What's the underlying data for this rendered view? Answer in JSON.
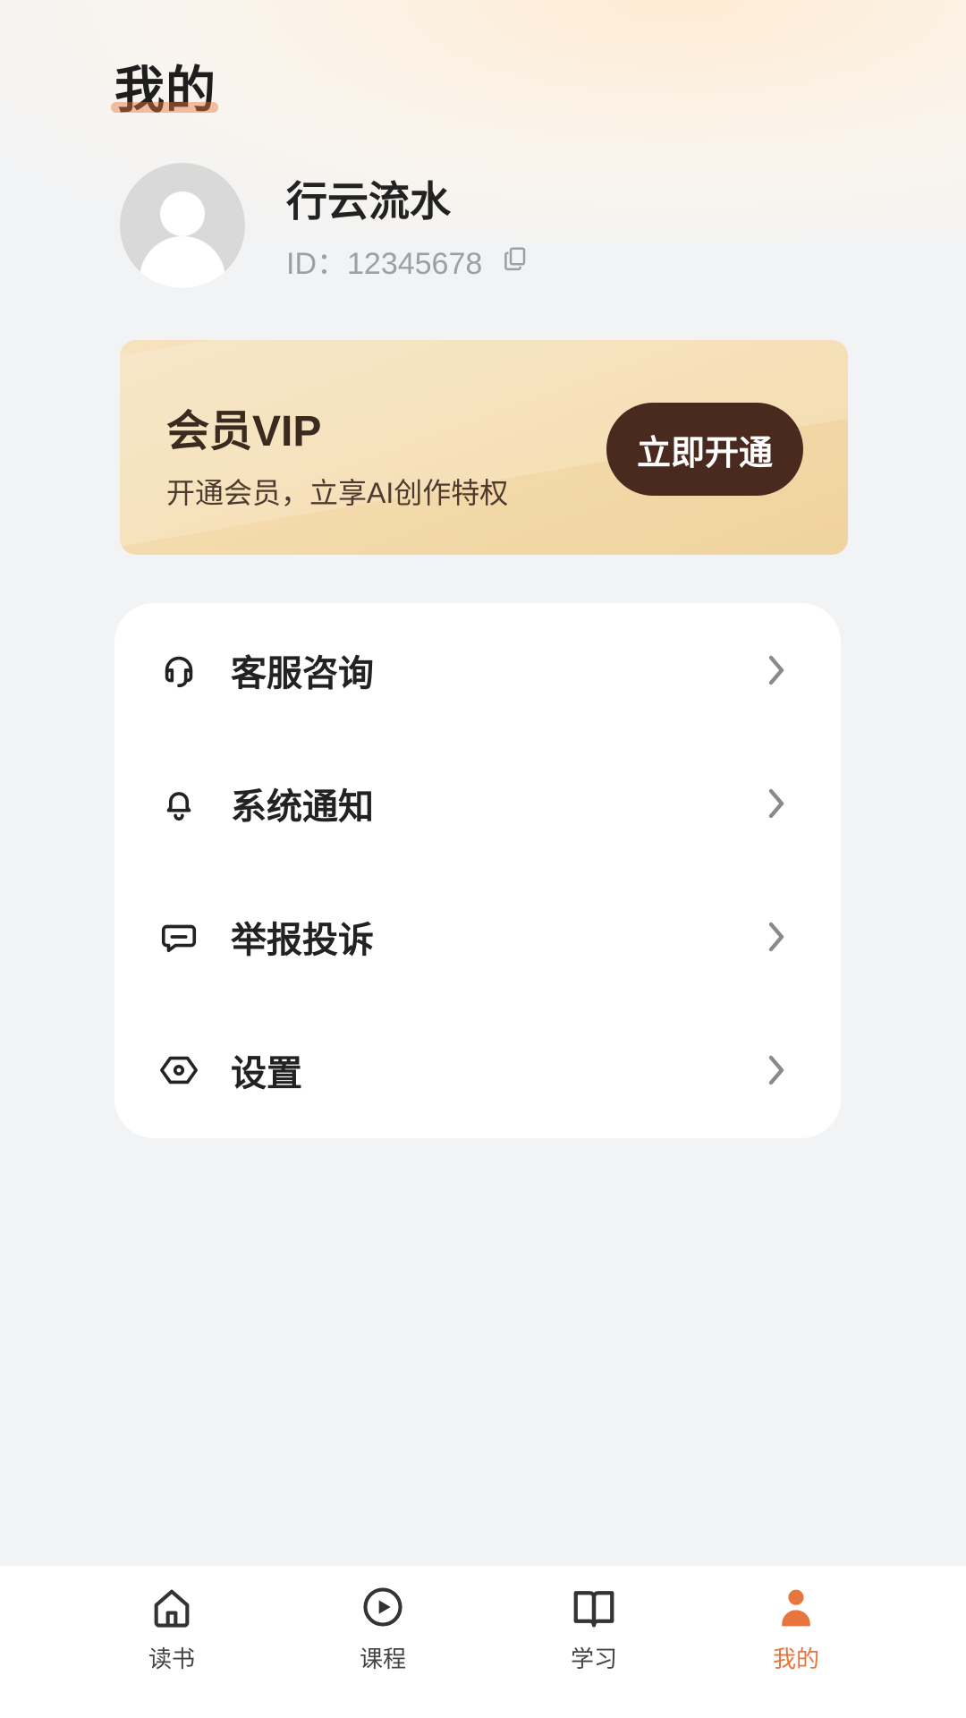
{
  "header": {
    "title": "我的"
  },
  "profile": {
    "username": "行云流水",
    "id_text": "ID：12345678",
    "copy_icon": "copy-icon",
    "avatar_icon": "default-avatar"
  },
  "vip": {
    "title": "会员VIP",
    "subtitle": "开通会员，立享AI创作特权",
    "button_label": "立即开通"
  },
  "menu": {
    "items": [
      {
        "label": "客服咨询",
        "icon": "headset-icon"
      },
      {
        "label": "系统通知",
        "icon": "bell-icon"
      },
      {
        "label": "举报投诉",
        "icon": "message-icon"
      },
      {
        "label": "设置",
        "icon": "settings-icon"
      }
    ],
    "chevron_icon": "chevron-right-icon"
  },
  "bottom_nav": {
    "items": [
      {
        "label": "读书",
        "icon": "home-icon",
        "active": false
      },
      {
        "label": "课程",
        "icon": "play-circle-icon",
        "active": false
      },
      {
        "label": "学习",
        "icon": "book-open-icon",
        "active": false
      },
      {
        "label": "我的",
        "icon": "user-icon",
        "active": true
      }
    ]
  },
  "colors": {
    "accent": "#e8753d",
    "vip_button": "#4a2a1e",
    "background": "#f2f3f5"
  }
}
